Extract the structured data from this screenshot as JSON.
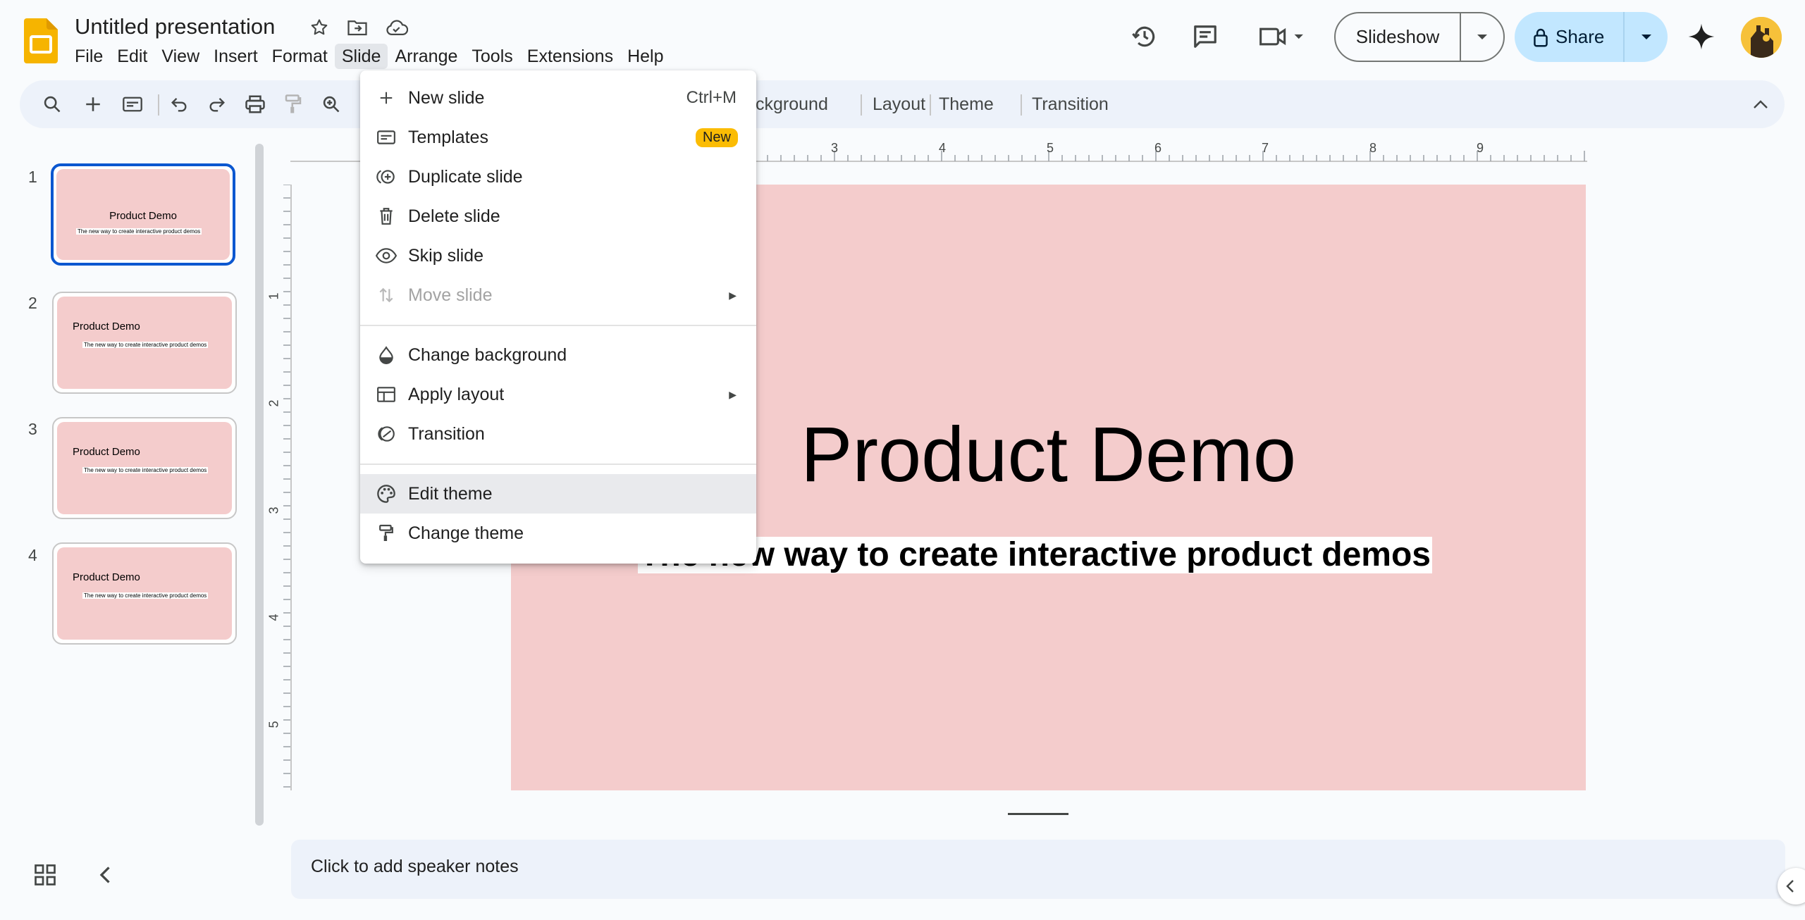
{
  "app": {
    "title": "Untitled presentation",
    "menus": [
      "File",
      "Edit",
      "View",
      "Insert",
      "Format",
      "Slide",
      "Arrange",
      "Tools",
      "Extensions",
      "Help"
    ],
    "active_menu": "Slide"
  },
  "header": {
    "slideshow_label": "Slideshow",
    "share_label": "Share"
  },
  "toolbar": {
    "text_buttons": [
      "ckground",
      "Layout",
      "Theme",
      "Transition"
    ]
  },
  "rulers": {
    "top_labels": [
      "3",
      "4",
      "5",
      "6",
      "7",
      "8",
      "9"
    ],
    "left_labels": [
      "1",
      "2",
      "3",
      "4",
      "5"
    ]
  },
  "slides": [
    {
      "number": "1",
      "title": "Product Demo",
      "subtitle": "The new way to create interactive product demos",
      "selected": true
    },
    {
      "number": "2",
      "title": "Product Demo",
      "subtitle": "The new way to create interactive product demos",
      "selected": false
    },
    {
      "number": "3",
      "title": "Product Demo",
      "subtitle": "The new way to create interactive product demos",
      "selected": false
    },
    {
      "number": "4",
      "title": "Product Demo",
      "subtitle": "The new way to create interactive product demos",
      "selected": false
    }
  ],
  "canvas": {
    "title": "Product Demo",
    "subtitle": "The new way to create interactive product demos",
    "background": "#f4cccc"
  },
  "notes": {
    "placeholder": "Click to add speaker notes"
  },
  "slide_menu": {
    "items": [
      {
        "label": "New slide",
        "shortcut": "Ctrl+M",
        "icon": "plus-icon"
      },
      {
        "label": "Templates",
        "badge": "New",
        "icon": "templates-icon"
      },
      {
        "label": "Duplicate slide",
        "icon": "duplicate-icon"
      },
      {
        "label": "Delete slide",
        "icon": "trash-icon"
      },
      {
        "label": "Skip slide",
        "icon": "eye-icon"
      },
      {
        "label": "Move slide",
        "icon": "move-icon",
        "disabled": true,
        "submenu": true
      },
      {
        "label": "Change background",
        "icon": "drop-icon"
      },
      {
        "label": "Apply layout",
        "icon": "layout-icon",
        "submenu": true
      },
      {
        "label": "Transition",
        "icon": "transition-icon"
      },
      {
        "label": "Edit theme",
        "icon": "palette-icon",
        "highlighted": true
      },
      {
        "label": "Change theme",
        "icon": "paint-roller-icon"
      }
    ]
  },
  "colors": {
    "accent": "#0b57d0",
    "share_bg": "#c2e7ff",
    "slide_bg": "#f4cccc",
    "toolbar_bg": "#edf2fa",
    "badge": "#fbbc04"
  }
}
